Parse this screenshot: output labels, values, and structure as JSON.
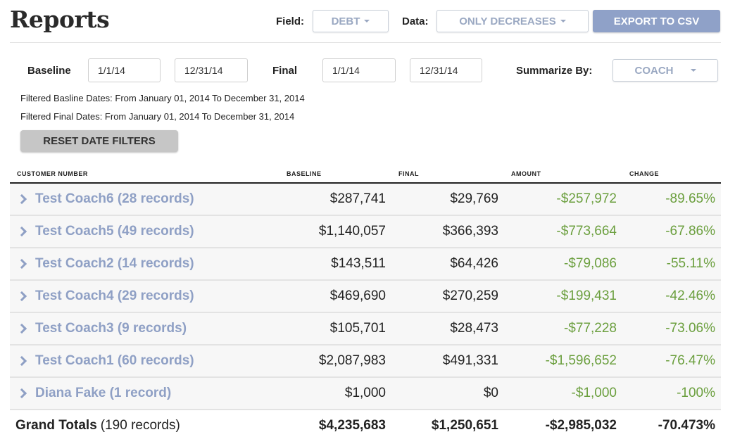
{
  "header": {
    "title": "Reports",
    "field_label": "Field:",
    "field_value": "DEBT",
    "data_label": "Data:",
    "data_value": "ONLY DECREASES",
    "export_label": "EXPORT TO CSV"
  },
  "filters": {
    "baseline_label": "Baseline",
    "baseline_start": "1/1/14",
    "baseline_end": "12/31/14",
    "final_label": "Final",
    "final_start": "1/1/14",
    "final_end": "12/31/14",
    "summarize_label": "Summarize By:",
    "summarize_value": "COACH",
    "baseline_note": "Filtered Basline Dates: From January 01, 2014 To December 31, 2014",
    "final_note": "Filtered Final Dates: From January 01, 2014 To December 31, 2014",
    "reset_label": "RESET DATE FILTERS"
  },
  "table": {
    "columns": [
      "CUSTOMER NUMBER",
      "BASELINE",
      "FINAL",
      "AMOUNT",
      "CHANGE"
    ],
    "rows": [
      {
        "name": "Test Coach6 (28 records)",
        "baseline": "$287,741",
        "final": "$29,769",
        "amount": "-$257,972",
        "change": "-89.65%"
      },
      {
        "name": "Test Coach5 (49 records)",
        "baseline": "$1,140,057",
        "final": "$366,393",
        "amount": "-$773,664",
        "change": "-67.86%"
      },
      {
        "name": "Test Coach2 (14 records)",
        "baseline": "$143,511",
        "final": "$64,426",
        "amount": "-$79,086",
        "change": "-55.11%"
      },
      {
        "name": "Test Coach4 (29 records)",
        "baseline": "$469,690",
        "final": "$270,259",
        "amount": "-$199,431",
        "change": "-42.46%"
      },
      {
        "name": "Test Coach3 (9 records)",
        "baseline": "$105,701",
        "final": "$28,473",
        "amount": "-$77,228",
        "change": "-73.06%"
      },
      {
        "name": "Test Coach1 (60 records)",
        "baseline": "$2,087,983",
        "final": "$491,331",
        "amount": "-$1,596,652",
        "change": "-76.47%"
      },
      {
        "name": "Diana Fake (1 record)",
        "baseline": "$1,000",
        "final": "$0",
        "amount": "-$1,000",
        "change": "-100%"
      }
    ],
    "totals": {
      "label": "Grand Totals",
      "records": "(190 records)",
      "baseline": "$4,235,683",
      "final": "$1,250,651",
      "amount": "-$2,985,032",
      "change": "-70.473%"
    }
  },
  "colors": {
    "accent": "#8fa1c8",
    "positive_green": "#6b9f3e"
  }
}
